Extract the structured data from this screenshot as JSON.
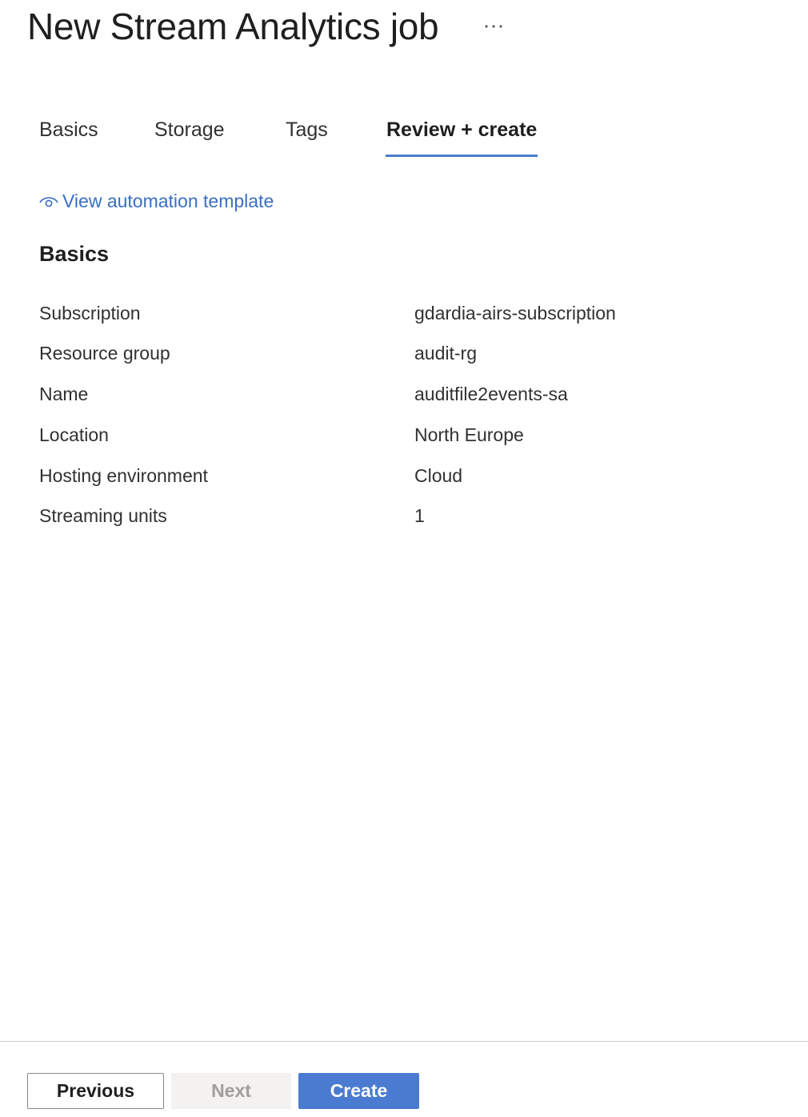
{
  "header": {
    "title": "New Stream Analytics job",
    "more_icon": "ellipsis-icon"
  },
  "tabs": [
    {
      "label": "Basics",
      "active": false
    },
    {
      "label": "Storage",
      "active": false
    },
    {
      "label": "Tags",
      "active": false
    },
    {
      "label": "Review + create",
      "active": true
    }
  ],
  "automation": {
    "icon": "eye-icon",
    "label": "View automation template"
  },
  "section": {
    "title": "Basics",
    "rows": [
      {
        "label": "Subscription",
        "value": "gdardia-airs-subscription"
      },
      {
        "label": "Resource group",
        "value": "audit-rg"
      },
      {
        "label": "Name",
        "value": "auditfile2events-sa"
      },
      {
        "label": "Location",
        "value": "North Europe"
      },
      {
        "label": "Hosting environment",
        "value": "Cloud"
      },
      {
        "label": "Streaming units",
        "value": "1"
      }
    ]
  },
  "footer": {
    "previous_label": "Previous",
    "next_label": "Next",
    "next_disabled": true,
    "create_label": "Create"
  },
  "colors": {
    "accent": "#4a7bd0",
    "link": "#3a6fc4",
    "text": "#323130",
    "disabled_bg": "#f3f2f1",
    "disabled_text": "#a19f9d"
  }
}
